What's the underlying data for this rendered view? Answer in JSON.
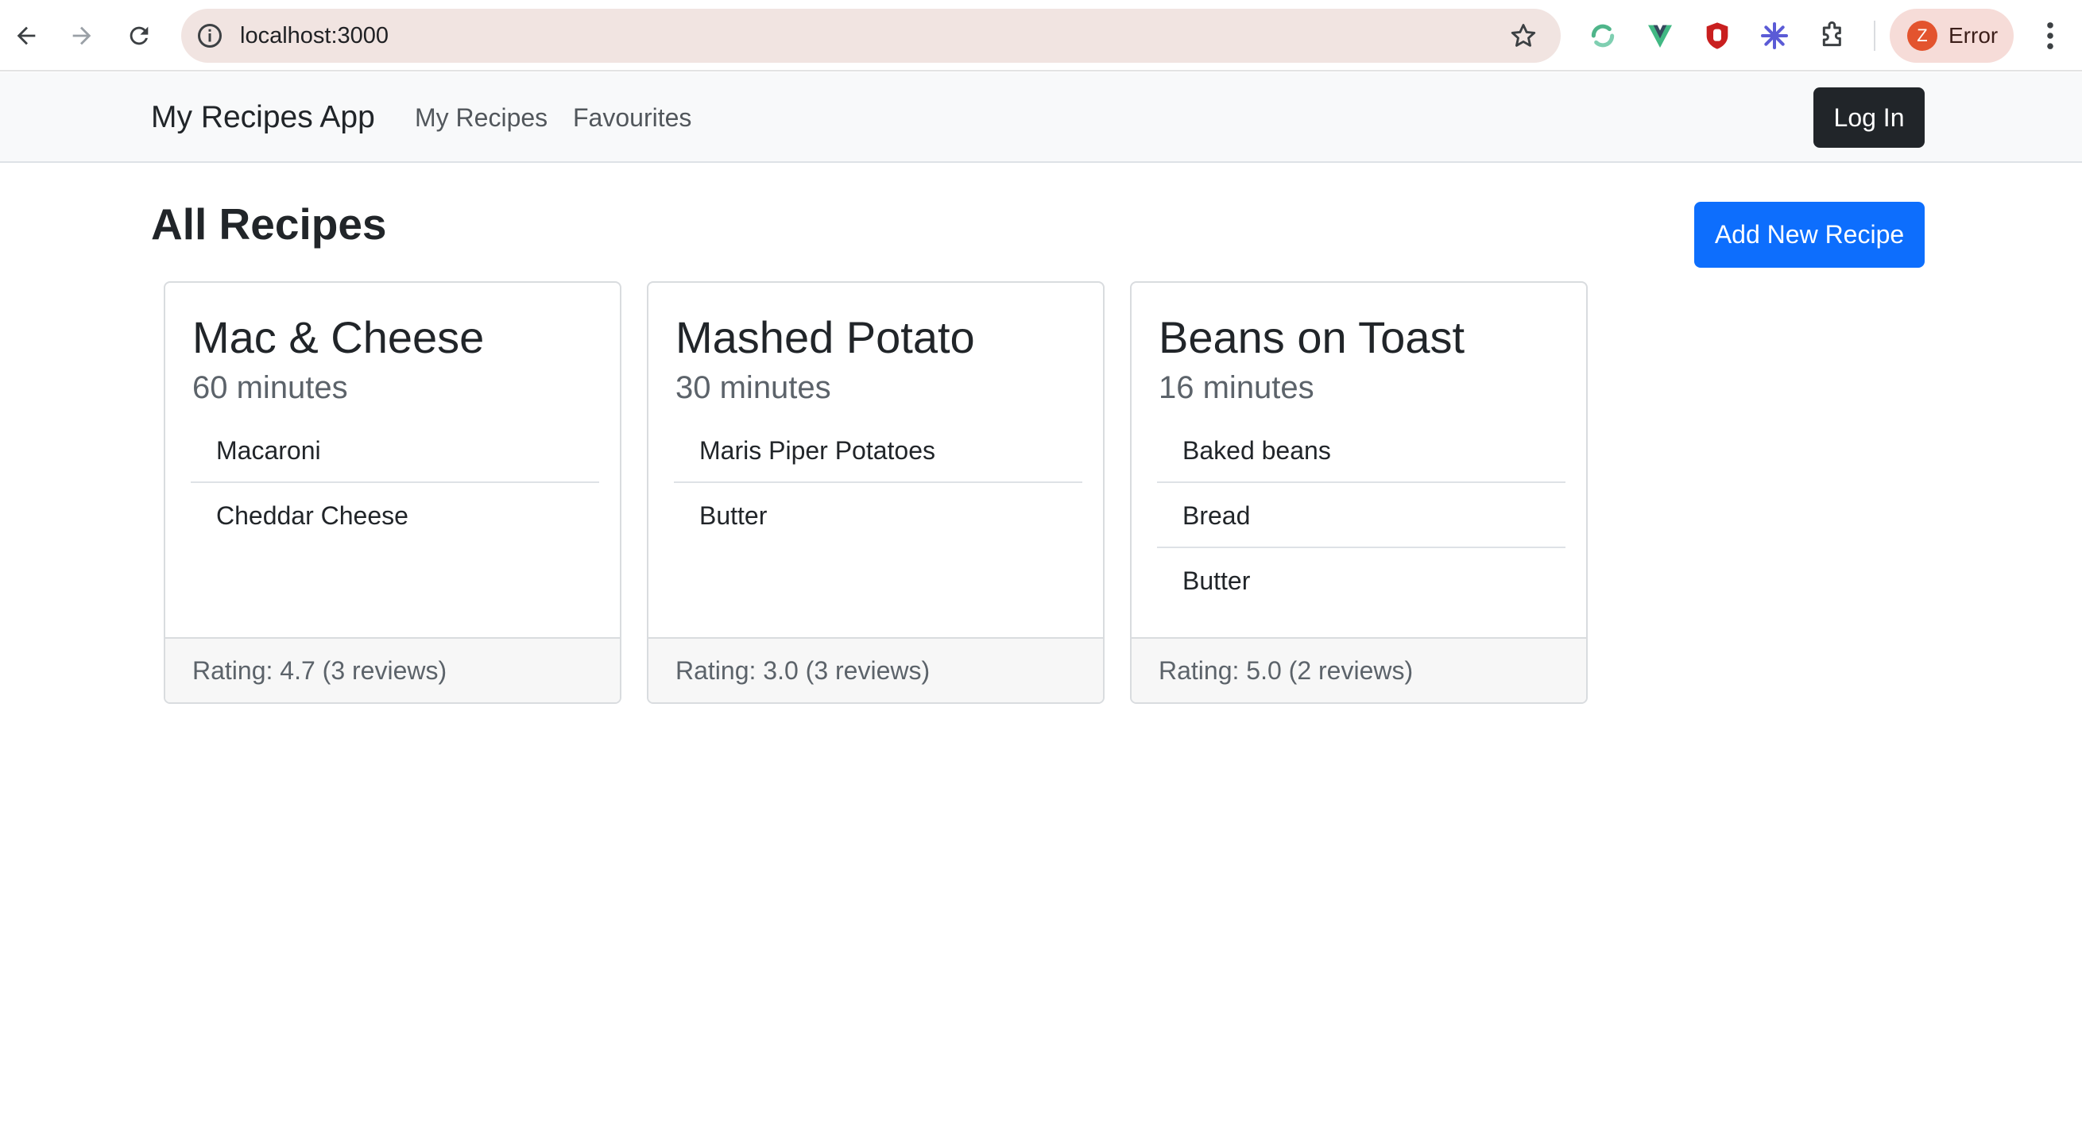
{
  "browser": {
    "url": "localhost:3000",
    "profile_initial": "Z",
    "profile_status": "Error",
    "extensions": [
      "sync-extension-icon",
      "vue-devtools-icon",
      "ublock-icon",
      "asterisk-extension-icon",
      "puzzle-extensions-icon"
    ]
  },
  "navbar": {
    "brand": "My Recipes App",
    "links": [
      "My Recipes",
      "Favourites"
    ],
    "login_label": "Log In"
  },
  "main": {
    "title": "All Recipes",
    "add_button_label": "Add New Recipe"
  },
  "recipes": [
    {
      "title": "Mac & Cheese",
      "time": "60 minutes",
      "ingredients": [
        "Macaroni",
        "Cheddar Cheese"
      ],
      "rating": "Rating: 4.7 (3 reviews)"
    },
    {
      "title": "Mashed Potato",
      "time": "30 minutes",
      "ingredients": [
        "Maris Piper Potatoes",
        "Butter"
      ],
      "rating": "Rating: 3.0 (3 reviews)"
    },
    {
      "title": "Beans on Toast",
      "time": "16 minutes",
      "ingredients": [
        "Baked beans",
        "Bread",
        "Butter"
      ],
      "rating": "Rating: 5.0 (2 reviews)"
    }
  ],
  "colors": {
    "primary": "#0d6efd",
    "dark": "#212529",
    "navbar_bg": "#f8f9fa",
    "omnibox_bg": "#f1e4e1",
    "profile_chip_bg": "#f6dcd8"
  }
}
